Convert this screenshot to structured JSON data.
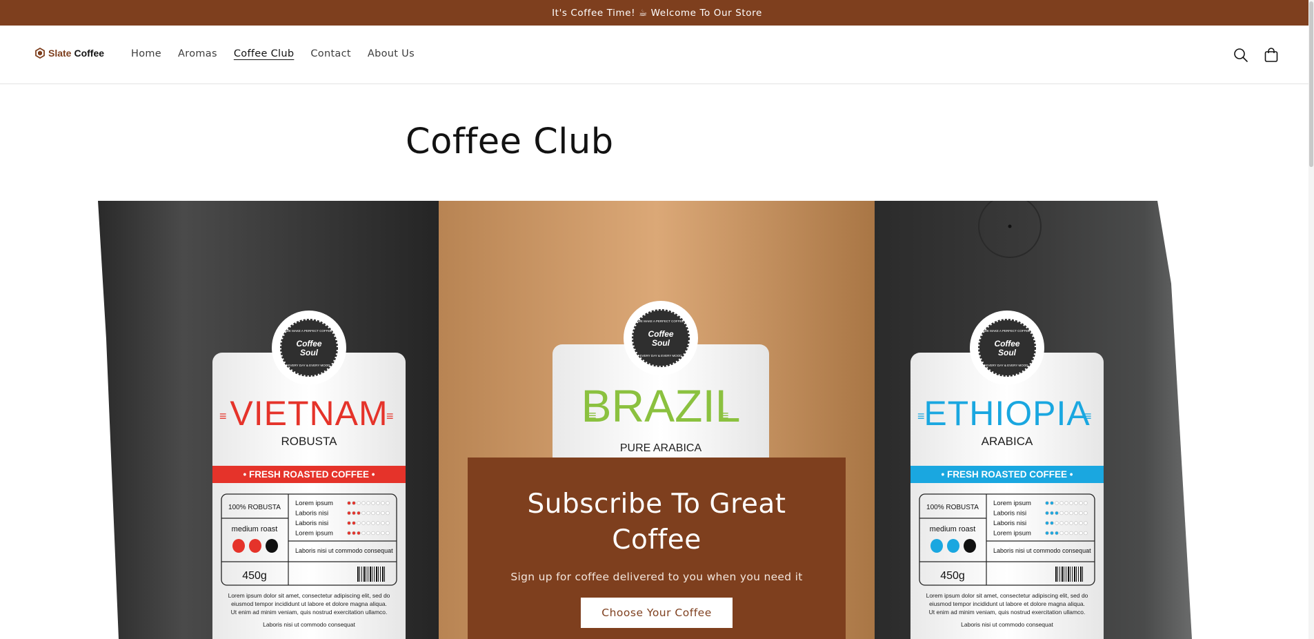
{
  "announcement": {
    "text": "It's Coffee Time! ☕ Welcome To Our Store"
  },
  "brand": {
    "word1": "Slate",
    "word2": "Coffee",
    "accent": "#7e3f1e"
  },
  "nav": {
    "items": [
      {
        "label": "Home"
      },
      {
        "label": "Aromas"
      },
      {
        "label": "Coffee Club",
        "active": true
      },
      {
        "label": "Contact"
      },
      {
        "label": "About Us"
      }
    ]
  },
  "header_icons": {
    "search": "search-icon",
    "cart": "cart-icon"
  },
  "page": {
    "title": "Coffee Club"
  },
  "hero": {
    "bags": [
      {
        "origin": "VIETNAM",
        "variety": "ROBUSTA",
        "origin_color": "#e5332a",
        "band": "• FRESH ROASTED COFFEE •",
        "purity": "100% ROBUSTA",
        "roast": "medium roast",
        "weight": "450g",
        "rows": [
          "Lorem ipsum",
          "Laboris nisi",
          "Laboris nisi",
          "Lorem ipsum"
        ],
        "note": "Laboris nisi ut commodo consequat",
        "body": [
          "Lorem ipsum dolor sit amet, consectetur adipiscing elit, sed do",
          "eiusmod tempor incididunt ut labore et dolore magna aliqua.",
          "Ut enim ad minim veniam, quis nostrud exercitation ullamco."
        ],
        "footer": "Laboris nisi ut commodo consequat"
      },
      {
        "origin": "BRAZIL",
        "variety": "PURE ARABICA",
        "origin_color": "#8bc13f"
      },
      {
        "origin": "ETHIOPIA",
        "variety": "ARABICA",
        "origin_color": "#1aa7e0",
        "band": "• FRESH ROASTED COFFEE •",
        "purity": "100% ROBUSTA",
        "roast": "medium roast",
        "weight": "450g",
        "rows": [
          "Lorem ipsum",
          "Laboris nisi",
          "Laboris nisi",
          "Lorem ipsum"
        ],
        "note": "Laboris nisi ut commodo consequat",
        "body": [
          "Lorem ipsum dolor sit amet, consectetur adipiscing elit, sed do",
          "eiusmod tempor incididunt ut labore et dolore magna aliqua.",
          "Ut enim ad minim veniam, quis nostrud exercitation ullamco."
        ],
        "footer": "Laboris nisi ut commodo consequat"
      }
    ],
    "badge": {
      "top": "WE MAKE A PERFECT COFFEE",
      "line1": "Coffee",
      "line2": "Soul",
      "bottom": "EVERY DAY & EVERY MOOD"
    }
  },
  "subscribe": {
    "title": "Subscribe To Great Coffee",
    "subtitle": "Sign up for coffee delivered to you when you need it",
    "button": "Choose Your Coffee"
  }
}
